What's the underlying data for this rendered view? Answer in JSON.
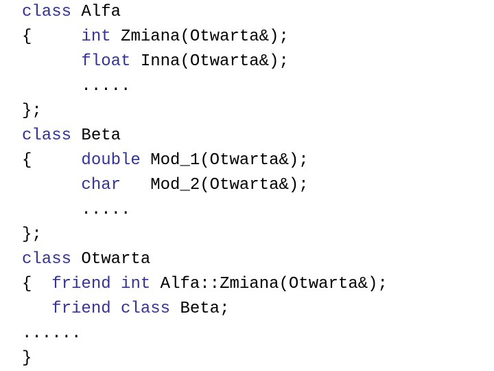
{
  "colors": {
    "keyword": "#333399",
    "text": "#000000",
    "background": "#ffffff"
  },
  "lines": [
    [
      {
        "t": "class",
        "k": true
      },
      {
        "t": " Alfa",
        "k": false
      }
    ],
    [
      {
        "t": "{     ",
        "k": false
      },
      {
        "t": "int",
        "k": true
      },
      {
        "t": " Zmiana(Otwarta&);",
        "k": false
      }
    ],
    [
      {
        "t": "      ",
        "k": false
      },
      {
        "t": "float",
        "k": true
      },
      {
        "t": " Inna(Otwarta&);",
        "k": false
      }
    ],
    [
      {
        "t": "      .....",
        "k": false
      }
    ],
    [
      {
        "t": "};",
        "k": false
      }
    ],
    [
      {
        "t": "class",
        "k": true
      },
      {
        "t": " Beta",
        "k": false
      }
    ],
    [
      {
        "t": "{     ",
        "k": false
      },
      {
        "t": "double",
        "k": true
      },
      {
        "t": " Mod_1(Otwarta&);",
        "k": false
      }
    ],
    [
      {
        "t": "      ",
        "k": false
      },
      {
        "t": "char",
        "k": true
      },
      {
        "t": "   Mod_2(Otwarta&);",
        "k": false
      }
    ],
    [
      {
        "t": "      .....",
        "k": false
      }
    ],
    [
      {
        "t": "};",
        "k": false
      }
    ],
    [
      {
        "t": "class",
        "k": true
      },
      {
        "t": " Otwarta",
        "k": false
      }
    ],
    [
      {
        "t": "{  ",
        "k": false
      },
      {
        "t": "friend",
        "k": true
      },
      {
        "t": " ",
        "k": false
      },
      {
        "t": "int",
        "k": true
      },
      {
        "t": " Alfa::Zmiana(Otwarta&);",
        "k": false
      }
    ],
    [
      {
        "t": "   ",
        "k": false
      },
      {
        "t": "friend",
        "k": true
      },
      {
        "t": " ",
        "k": false
      },
      {
        "t": "class",
        "k": true
      },
      {
        "t": " Beta;",
        "k": false
      }
    ],
    [
      {
        "t": "......",
        "k": false
      }
    ],
    [
      {
        "t": "}",
        "k": false
      }
    ]
  ]
}
